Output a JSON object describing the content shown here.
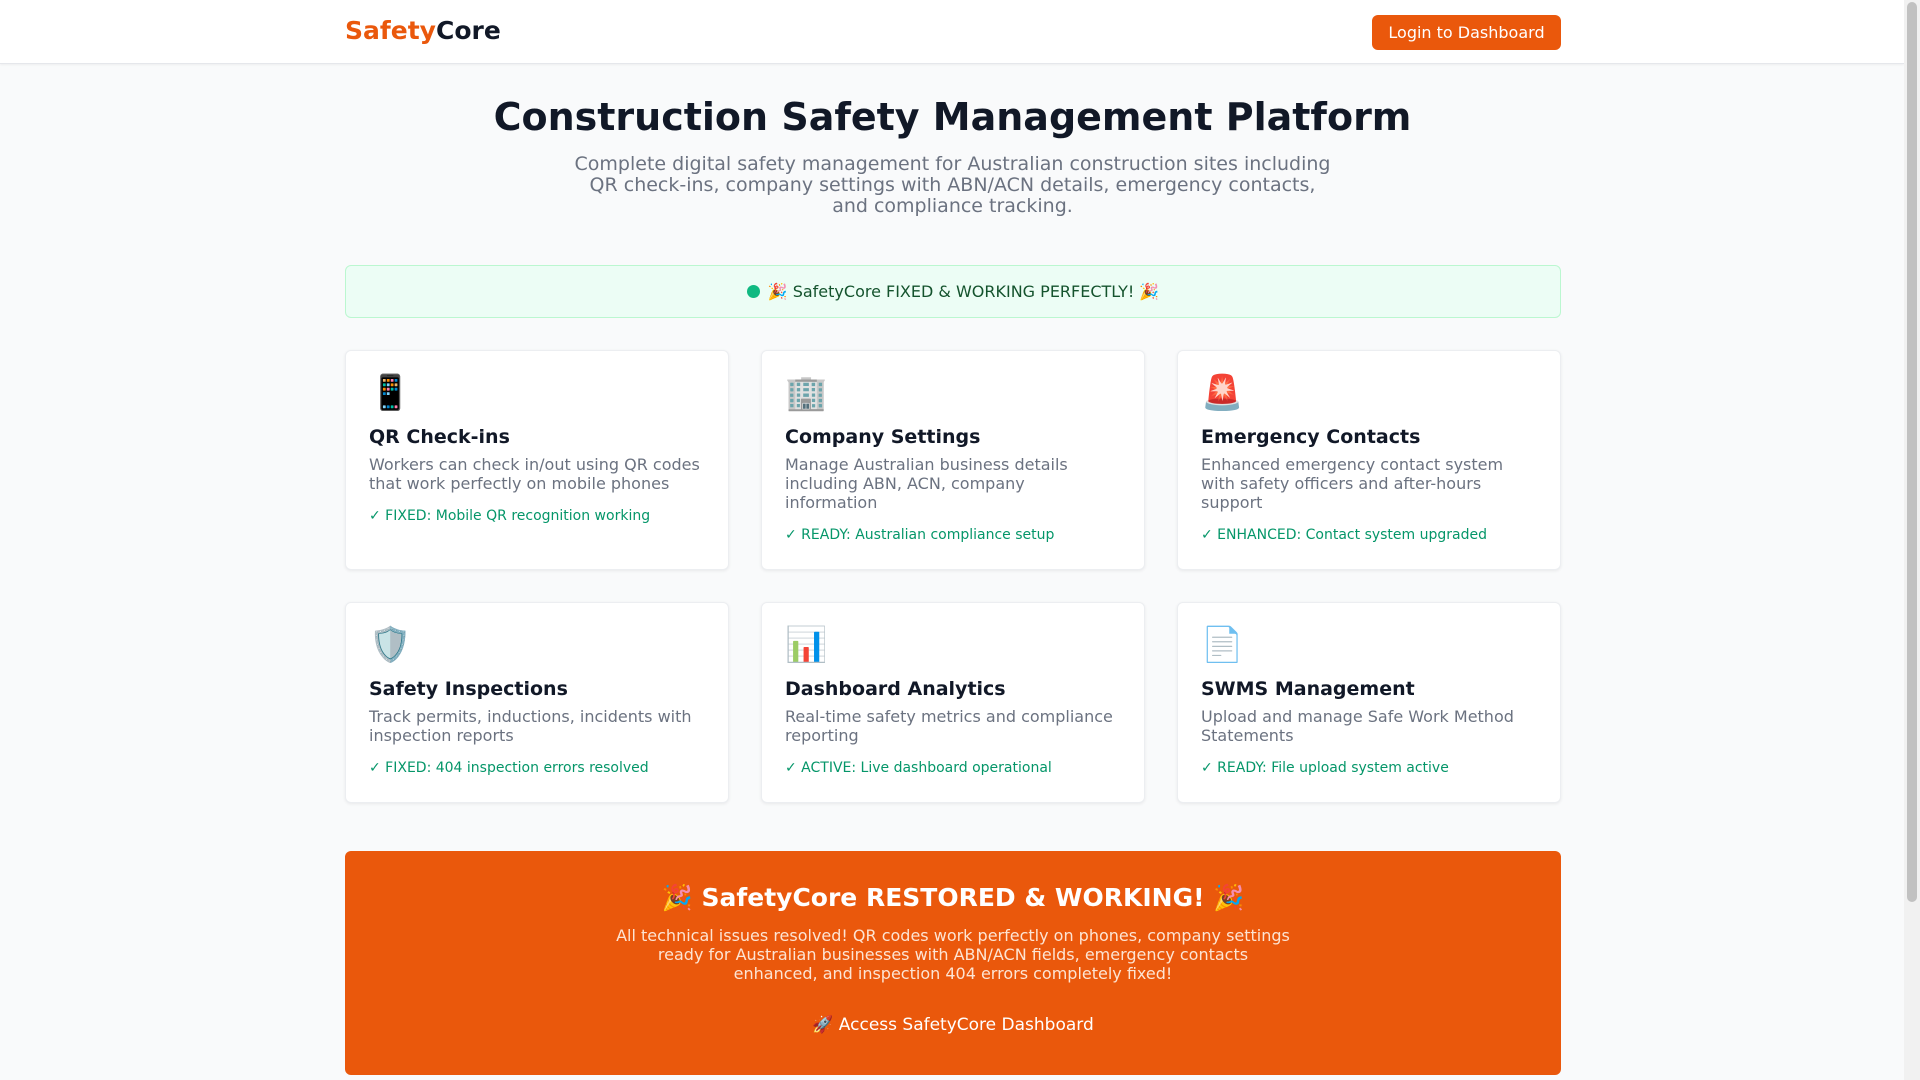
{
  "header": {
    "logo_part1": "Safety",
    "logo_part2": "Core",
    "login_label": "Login to Dashboard"
  },
  "hero": {
    "title": "Construction Safety Management Platform",
    "subtitle": "Complete digital safety management for Australian construction sites including QR check-ins, company settings with ABN/ACN details, emergency contacts, and compliance tracking."
  },
  "status_banner": {
    "text": "🎉 SafetyCore FIXED & WORKING PERFECTLY! 🎉"
  },
  "cards": [
    {
      "icon": "📱",
      "icon_name": "mobile-phone-icon",
      "title": "QR Check-ins",
      "desc": "Workers can check in/out using QR codes that work perfectly on mobile phones",
      "status": "✓ FIXED: Mobile QR recognition working"
    },
    {
      "icon": "🏢",
      "icon_name": "office-building-icon",
      "title": "Company Settings",
      "desc": "Manage Australian business details including ABN, ACN, company information",
      "status": "✓ READY: Australian compliance setup"
    },
    {
      "icon": "🚨",
      "icon_name": "siren-icon",
      "title": "Emergency Contacts",
      "desc": "Enhanced emergency contact system with safety officers and after-hours support",
      "status": "✓ ENHANCED: Contact system upgraded"
    },
    {
      "icon": "🛡️",
      "icon_name": "shield-icon",
      "title": "Safety Inspections",
      "desc": "Track permits, inductions, incidents with inspection reports",
      "status": "✓ FIXED: 404 inspection errors resolved"
    },
    {
      "icon": "📊",
      "icon_name": "bar-chart-icon",
      "title": "Dashboard Analytics",
      "desc": "Real-time safety metrics and compliance reporting",
      "status": "✓ ACTIVE: Live dashboard operational"
    },
    {
      "icon": "📄",
      "icon_name": "document-icon",
      "title": "SWMS Management",
      "desc": "Upload and manage Safe Work Method Statements",
      "status": "✓ READY: File upload system active"
    }
  ],
  "cta": {
    "title": "🎉 SafetyCore RESTORED & WORKING! 🎉",
    "body": "All technical issues resolved! QR codes work perfectly on phones, company settings ready for Australian businesses with ABN/ACN fields, emergency contacts enhanced, and inspection 404 errors completely fixed!",
    "link_label": "🚀 Access SafetyCore Dashboard"
  },
  "colors": {
    "brand": "#ea580c",
    "success": "#059669",
    "success_bg": "#ecfdf5"
  }
}
